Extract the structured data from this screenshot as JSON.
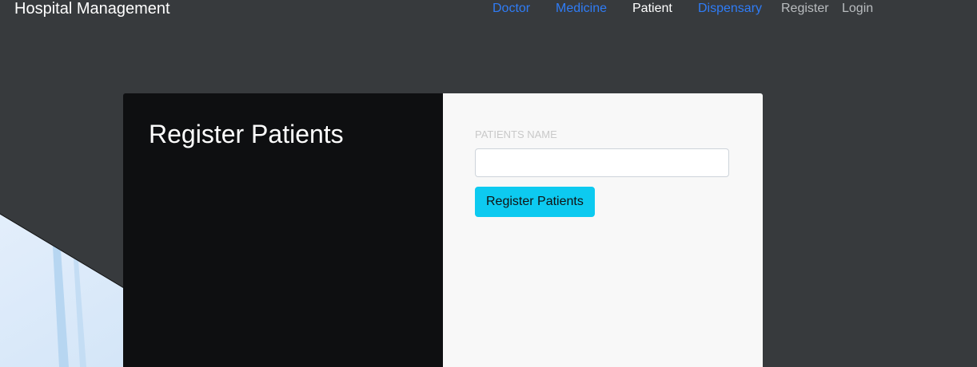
{
  "navbar": {
    "brand": "Hospital Management",
    "links": [
      {
        "label": "Doctor"
      },
      {
        "label": "Medicine"
      },
      {
        "label": "Patient"
      },
      {
        "label": "Dispensary"
      },
      {
        "label": "Register"
      },
      {
        "label": "Login"
      }
    ]
  },
  "card": {
    "title": "Register Patients",
    "form": {
      "field_label": "PATIENTS NAME",
      "field_value": "",
      "field_placeholder": "",
      "submit_label": "Register Patients"
    }
  },
  "colors": {
    "background": "#373a3d",
    "card_dark": "#0e0f11",
    "card_light": "#f8f8f8",
    "nav_link": "#2f7cf6",
    "button": "#0dcaf0"
  },
  "icons": [
    "hospital-background-image"
  ]
}
